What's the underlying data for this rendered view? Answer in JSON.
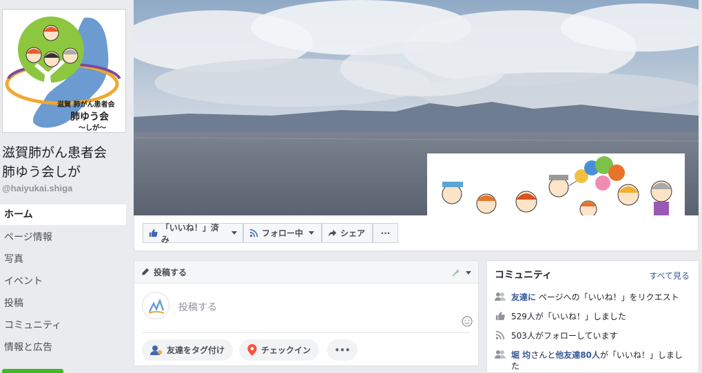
{
  "page": {
    "name_line1": "滋賀肺がん患者会",
    "name_line2": "肺ゆう会しが",
    "handle": "@haiyukai.shiga",
    "logo_line1": "滋賀 肺がん患者会",
    "logo_line2": "肺ゆう会",
    "logo_line3": "〜しが〜"
  },
  "nav": {
    "items": [
      {
        "label": "ホーム",
        "active": true
      },
      {
        "label": "ページ情報"
      },
      {
        "label": "写真"
      },
      {
        "label": "イベント"
      },
      {
        "label": "投稿"
      },
      {
        "label": "コミュニティ"
      },
      {
        "label": "情報と広告"
      }
    ]
  },
  "actions": {
    "like_label": "「いいね！」済み",
    "follow_label": "フォロー中",
    "share_label": "シェア",
    "more_label": "···"
  },
  "composer": {
    "header": "投稿する",
    "placeholder": "投稿する",
    "tag_friends": "友達をタグ付け",
    "check_in": "チェックイン",
    "more": "•••"
  },
  "community": {
    "title": "コミュニティ",
    "see_all": "すべて見る",
    "invite_link": "友達に",
    "invite_rest": "ページへの「いいね！」をリクエスト",
    "likes": "529人が「いいね！」しました",
    "follows": "503人がフォローしています",
    "friend_name": "堀 均",
    "friend_mid": "さんと",
    "friend_others": "他友達80人",
    "friend_rest": "が「いいね！」しまし",
    "friend_rest2": "た"
  },
  "colors": {
    "brand_blue": "#4267b2",
    "link": "#365899",
    "green": "#42b72a"
  }
}
